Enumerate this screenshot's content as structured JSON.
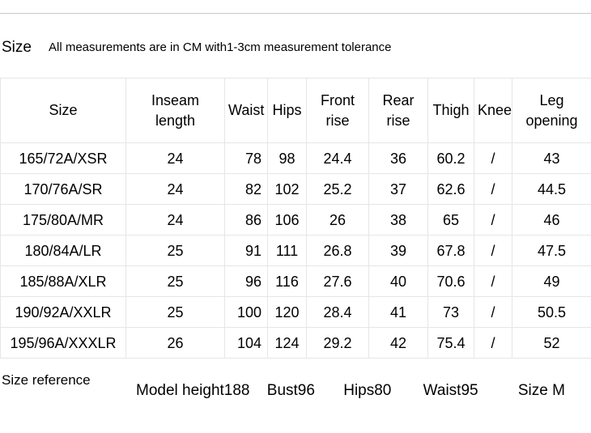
{
  "caption": {
    "title": "Size",
    "note": "All measurements are in CM with1-3cm measurement tolerance"
  },
  "table": {
    "headers": [
      "Size",
      "Inseam length",
      "Waist",
      "Hips",
      "Front rise",
      "Rear rise",
      "Thigh",
      "Knee",
      "Leg opening"
    ],
    "rows": [
      {
        "size": "165/72A/XSR",
        "inseam_length": "24",
        "waist": "78",
        "hips": "98",
        "front_rise": "24.4",
        "rear_rise": "36",
        "thigh": "60.2",
        "knee": "/",
        "leg_opening": "43"
      },
      {
        "size": "170/76A/SR",
        "inseam_length": "24",
        "waist": "82",
        "hips": "102",
        "front_rise": "25.2",
        "rear_rise": "37",
        "thigh": "62.6",
        "knee": "/",
        "leg_opening": "44.5"
      },
      {
        "size": "175/80A/MR",
        "inseam_length": "24",
        "waist": "86",
        "hips": "106",
        "front_rise": "26",
        "rear_rise": "38",
        "thigh": "65",
        "knee": "/",
        "leg_opening": "46"
      },
      {
        "size": "180/84A/LR",
        "inseam_length": "25",
        "waist": "91",
        "hips": "111",
        "front_rise": "26.8",
        "rear_rise": "39",
        "thigh": "67.8",
        "knee": "/",
        "leg_opening": "47.5"
      },
      {
        "size": "185/88A/XLR",
        "inseam_length": "25",
        "waist": "96",
        "hips": "116",
        "front_rise": "27.6",
        "rear_rise": "40",
        "thigh": "70.6",
        "knee": "/",
        "leg_opening": "49"
      },
      {
        "size": "190/92A/XXLR",
        "inseam_length": "25",
        "waist": "100",
        "hips": "120",
        "front_rise": "28.4",
        "rear_rise": "41",
        "thigh": "73",
        "knee": "/",
        "leg_opening": "50.5"
      },
      {
        "size": "195/96A/XXXLR",
        "inseam_length": "26",
        "waist": "104",
        "hips": "124",
        "front_rise": "29.2",
        "rear_rise": "42",
        "thigh": "75.4",
        "knee": "/",
        "leg_opening": "52"
      }
    ]
  },
  "size_reference": {
    "label": "Size reference",
    "model_height": "Model height188",
    "bust": "Bust96",
    "hips": "Hips80",
    "waist": "Waist95",
    "size": "Size M"
  },
  "colors": {
    "text": "#000000",
    "grid_line": "#e6e6e6",
    "top_rule": "#c8c8c8",
    "background": "#ffffff"
  }
}
